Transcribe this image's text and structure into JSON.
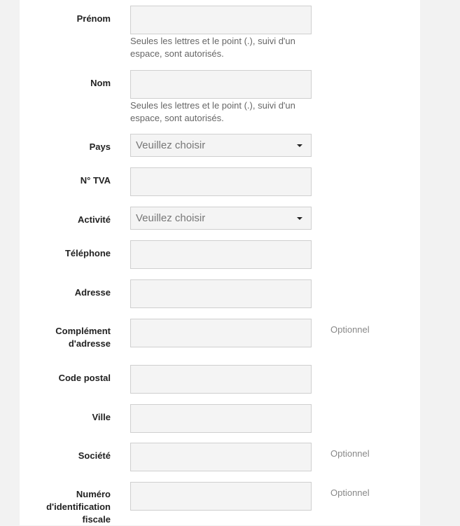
{
  "fields": [
    {
      "label": "Prénom",
      "help": "Seules les lettres et le point (.), suivi d'un espace, sont autorisés."
    },
    {
      "label": "Nom",
      "help": "Seules les lettres et le point (.), suivi d'un espace, sont autorisés."
    },
    {
      "label": "Pays",
      "value": "Veuillez choisir"
    },
    {
      "label": "N° TVA"
    },
    {
      "label": "Activité",
      "value": "Veuillez choisir"
    },
    {
      "label": "Téléphone"
    },
    {
      "label": "Adresse"
    },
    {
      "label": "Complément d'adresse",
      "optional": "Optionnel"
    },
    {
      "label": "Code postal"
    },
    {
      "label": "Ville"
    },
    {
      "label": "Société",
      "optional": "Optionnel"
    },
    {
      "label": "Numéro d'identification fiscale",
      "optional": "Optionnel"
    }
  ]
}
